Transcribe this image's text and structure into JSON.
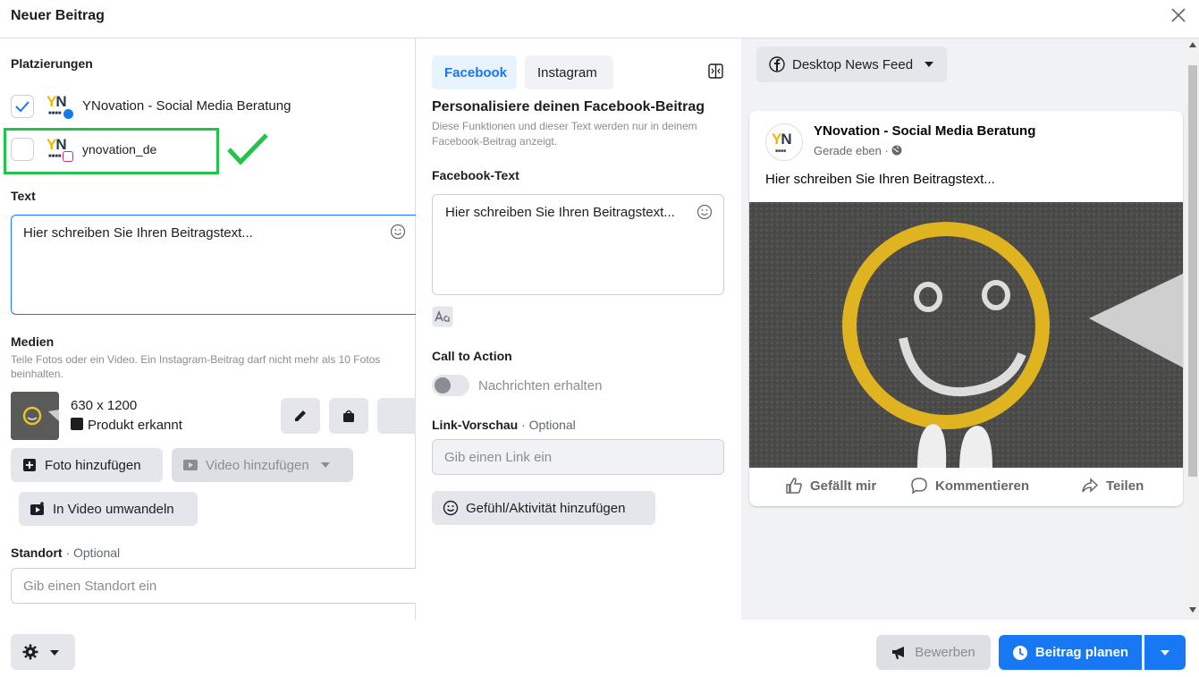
{
  "dialog": {
    "title": "Neuer Beitrag"
  },
  "placements": {
    "title": "Platzierungen",
    "items": [
      {
        "name": "YNovation - Social Media Beratung",
        "checked": true,
        "network": "facebook"
      },
      {
        "name": "ynovation_de",
        "checked": false,
        "network": "instagram"
      }
    ],
    "logo_text": {
      "y": "Y",
      "n": "N",
      "dots": "■■■■"
    }
  },
  "text_section": {
    "title": "Text",
    "value": "Hier schreiben Sie Ihren Beitragstext..."
  },
  "media": {
    "title": "Medien",
    "description": "Teile Fotos oder ein Video. Ein Instagram-Beitrag darf nicht mehr als 10 Fotos beinhalten.",
    "dimensions": "630 x 1200",
    "product_detected": "Produkt erkannt",
    "add_photo": "Foto hinzufügen",
    "add_video": "Video hinzufügen",
    "convert_video": "In Video umwandeln"
  },
  "location": {
    "title": "Standort",
    "optional": "· Optional",
    "placeholder": "Gib einen Standort ein"
  },
  "tabs": {
    "facebook": "Facebook",
    "instagram": "Instagram"
  },
  "personalize": {
    "title": "Personalisiere deinen Facebook-Beitrag",
    "description": "Diese Funktionen und dieser Text werden nur in deinem Facebook-Beitrag anzeigt."
  },
  "facebook_text": {
    "title": "Facebook-Text",
    "value": "Hier schreiben Sie Ihren Beitragstext..."
  },
  "cta": {
    "title": "Call to Action",
    "toggle_label": "Nachrichten erhalten",
    "enabled": false
  },
  "link_preview": {
    "title": "Link-Vorschau",
    "optional": "· Optional",
    "placeholder": "Gib einen Link ein"
  },
  "feeling": {
    "label": "Gefühl/Aktivität hinzufügen"
  },
  "preview": {
    "feed_select": "Desktop News Feed",
    "page_name": "YNovation - Social Media Beratung",
    "time": "Gerade eben ·",
    "post_text": "Hier schreiben Sie Ihren Beitragstext...",
    "like": "Gefällt mir",
    "comment": "Kommentieren",
    "share": "Teilen"
  },
  "footer": {
    "promote": "Bewerben",
    "schedule": "Beitrag planen"
  },
  "colors": {
    "accent": "#1877f2",
    "highlight": "#22c34b",
    "logo_yellow": "#f2b600",
    "logo_dark": "#2a3948"
  }
}
